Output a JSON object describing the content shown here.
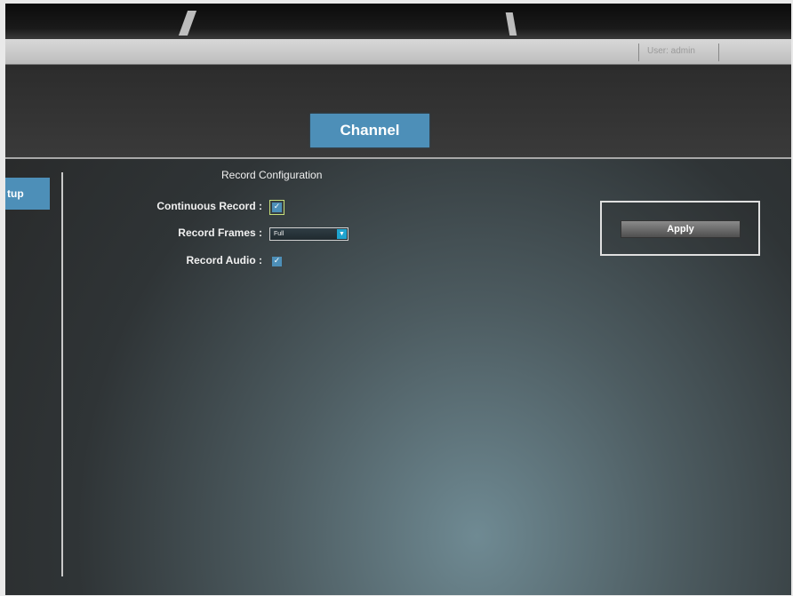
{
  "topbar": {
    "user_label": "User: admin"
  },
  "header": {
    "tab_label": "Channel"
  },
  "sidebar": {
    "active_item_label": "tup"
  },
  "section": {
    "title": "Record Configuration"
  },
  "form": {
    "continuous_record": {
      "label": "Continuous Record :",
      "checked": true
    },
    "record_frames": {
      "label": "Record Frames :",
      "value": "Full"
    },
    "record_audio": {
      "label": "Record Audio :",
      "checked": true
    }
  },
  "apply": {
    "label": "Apply"
  },
  "colors": {
    "accent": "#4d8fb8",
    "background": "#2f3436"
  }
}
